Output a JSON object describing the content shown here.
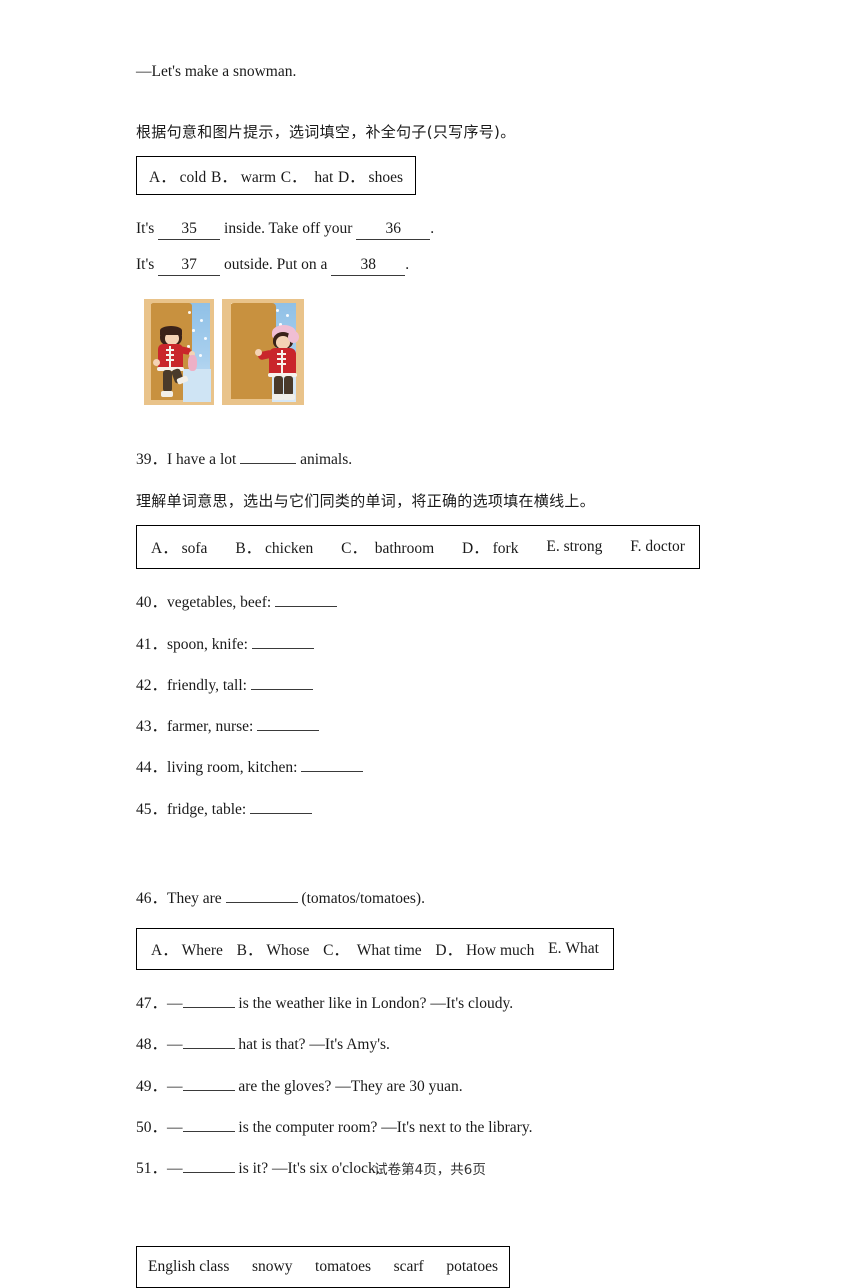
{
  "document": {
    "top_dialog_line": "—Let's make a snowman.",
    "footer": "试卷第4页，共6页"
  },
  "section_picture_cloze": {
    "instruction": "根据句意和图片提示，选词填空，补全句子(只写序号)。",
    "options": [
      {
        "letter": "A．",
        "text": "cold"
      },
      {
        "letter": "B．",
        "text": "warm"
      },
      {
        "letter": "C．",
        "text": "hat"
      },
      {
        "letter": "D．",
        "text": "shoes"
      }
    ],
    "sentences": [
      {
        "prefix": "It's",
        "blank1": "35",
        "middle": "inside. Take off your",
        "blank2": "36",
        "suffix": "."
      },
      {
        "prefix": "It's",
        "blank1": "37",
        "middle": "outside. Put on a",
        "blank2": "38",
        "suffix": "."
      }
    ],
    "figures": [
      {
        "caption": "child-taking-off-coat-indoors"
      },
      {
        "caption": "child-wearing-coat-and-hat-outdoors"
      }
    ]
  },
  "question_39": {
    "number": "39．",
    "before_blank": "I have a lot",
    "after_blank": "animals."
  },
  "section_categorize": {
    "instruction": "理解单词意思，选出与它们同类的单词，将正确的选项填在横线上。",
    "options": [
      {
        "letter": "A．",
        "text": "sofa"
      },
      {
        "letter": "B．",
        "text": "chicken"
      },
      {
        "letter": "C．",
        "text": "bathroom"
      },
      {
        "letter": "D．",
        "text": "fork"
      },
      {
        "letter": "E.",
        "text": "strong"
      },
      {
        "letter": "F.",
        "text": "doctor"
      }
    ],
    "items": [
      {
        "number": "40．",
        "text": "vegetables, beef:"
      },
      {
        "number": "41．",
        "text": "spoon, knife:"
      },
      {
        "number": "42．",
        "text": "friendly, tall:"
      },
      {
        "number": "43．",
        "text": "farmer, nurse:"
      },
      {
        "number": "44．",
        "text": "living room, kitchen:"
      },
      {
        "number": "45．",
        "text": "fridge, table:"
      }
    ]
  },
  "question_46": {
    "number": "46．",
    "before_blank": "They are",
    "after_blank": "(tomatos/tomatoes)."
  },
  "section_question_words": {
    "options": [
      {
        "letter": "A．",
        "text": "Where"
      },
      {
        "letter": "B．",
        "text": "Whose"
      },
      {
        "letter": "C．",
        "text": "What time"
      },
      {
        "letter": "D．",
        "text": "How much"
      },
      {
        "letter": "E.",
        "text": "What"
      }
    ],
    "items": [
      {
        "number": "47．",
        "dash": "—",
        "text": "is the weather like in London? —It's cloudy."
      },
      {
        "number": "48．",
        "dash": "—",
        "text": "hat is that? —It's Amy's."
      },
      {
        "number": "49．",
        "dash": "—",
        "text": "are the gloves? —They are 30 yuan."
      },
      {
        "number": "50．",
        "dash": "—",
        "text": "is the computer room? —It's next to the library."
      },
      {
        "number": "51．",
        "dash": "—",
        "text": "is it? —It's six o'clock."
      }
    ]
  },
  "word_bank": {
    "words": [
      "English class",
      "snowy",
      "tomatoes",
      "scarf",
      "potatoes"
    ]
  },
  "colors": {
    "door": "#c8913f",
    "window": "#a8cfee",
    "coat": "#c9262b",
    "frame": "#e9c38a",
    "text": "#1a1a1a"
  }
}
